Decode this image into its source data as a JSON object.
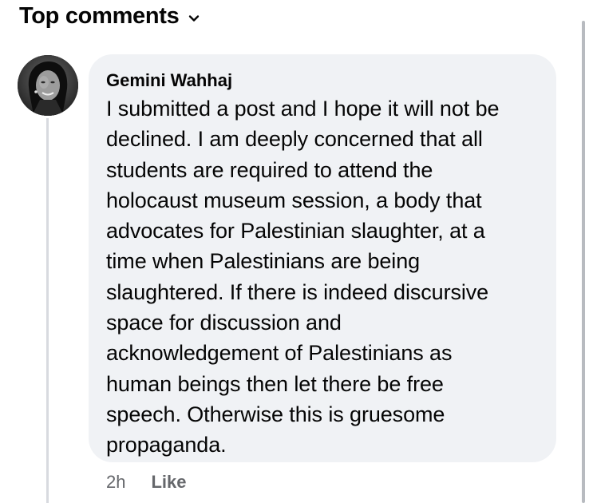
{
  "section": {
    "title": "Top comments",
    "chevron_icon": "chevron-down-icon"
  },
  "comment": {
    "author": "Gemini Wahhaj",
    "avatar_icon": "profile-photo",
    "text_lines": [
      "I submitted a post and I hope it will not be",
      "declined. I am deeply concerned that all",
      "students are required to attend the",
      "holocaust museum session, a body that",
      "advocates for Palestinian slaughter, at a",
      "time when Palestinians are being",
      "slaughtered. If there is indeed discursive",
      "space for discussion and",
      "acknowledgement of Palestinians as",
      "human beings then let there be free",
      "speech. Otherwise this is gruesome",
      "propaganda."
    ],
    "timestamp": "2h",
    "like_label": "Like"
  },
  "colors": {
    "bubble_bg": "#f0f2f5",
    "text": "#050505",
    "meta_text": "#65676b",
    "thread_line": "#d8dadf"
  }
}
